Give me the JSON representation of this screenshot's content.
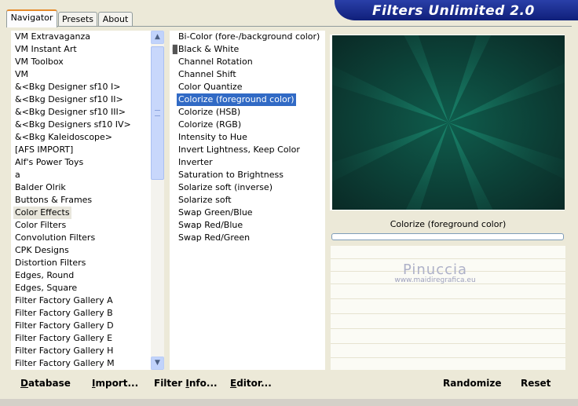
{
  "header": {
    "title": "Filters Unlimited 2.0"
  },
  "tabs": [
    {
      "label": "Navigator",
      "active": true
    },
    {
      "label": "Presets",
      "active": false
    },
    {
      "label": "About",
      "active": false
    }
  ],
  "categories": [
    "VM Extravaganza",
    "VM Instant Art",
    "VM Toolbox",
    "VM",
    "&<Bkg Designer sf10 I>",
    "&<Bkg Designer sf10 II>",
    "&<Bkg Designer sf10 III>",
    "&<Bkg Designers sf10 IV>",
    "&<Bkg Kaleidoscope>",
    "[AFS IMPORT]",
    "Alf's Power Toys",
    "a",
    "Balder Olrik",
    "Buttons & Frames",
    "Color Effects",
    "Color Filters",
    "Convolution Filters",
    "CPK Designs",
    "Distortion Filters",
    "Edges, Round",
    "Edges, Square",
    "Filter Factory Gallery A",
    "Filter Factory Gallery B",
    "Filter Factory Gallery D",
    "Filter Factory Gallery E",
    "Filter Factory Gallery H",
    "Filter Factory Gallery M"
  ],
  "selected_category": "Color Effects",
  "filters": [
    "Bi-Color (fore-/background color)",
    "Black & White",
    "Channel Rotation",
    "Channel Shift",
    "Color Quantize",
    "Colorize (foreground color)",
    "Colorize (HSB)",
    "Colorize (RGB)",
    "Intensity to Hue",
    "Invert Lightness, Keep Color",
    "Inverter",
    "Saturation to Brightness",
    "Solarize soft (inverse)",
    "Solarize soft",
    "Swap Green/Blue",
    "Swap Red/Blue",
    "Swap Red/Green"
  ],
  "selected_filter": "Colorize (foreground color)",
  "preview": {
    "filter_label": "Colorize (foreground color)",
    "progress": 0
  },
  "watermark": {
    "line1": "Pinuccia",
    "line2": "www.maidiregrafica.eu"
  },
  "buttons": {
    "database": {
      "first": "D",
      "rest": "atabase"
    },
    "import": {
      "first": "I",
      "rest": "mport..."
    },
    "filter_info": {
      "pre": "Filter ",
      "first": "I",
      "rest": "nfo..."
    },
    "editor": {
      "first": "E",
      "rest": "ditor..."
    },
    "randomize": "Randomize",
    "reset": "Reset"
  },
  "colors": {
    "banner": "#1a2d96",
    "selection": "#316ac5",
    "preview_center": "#0e6b58"
  }
}
